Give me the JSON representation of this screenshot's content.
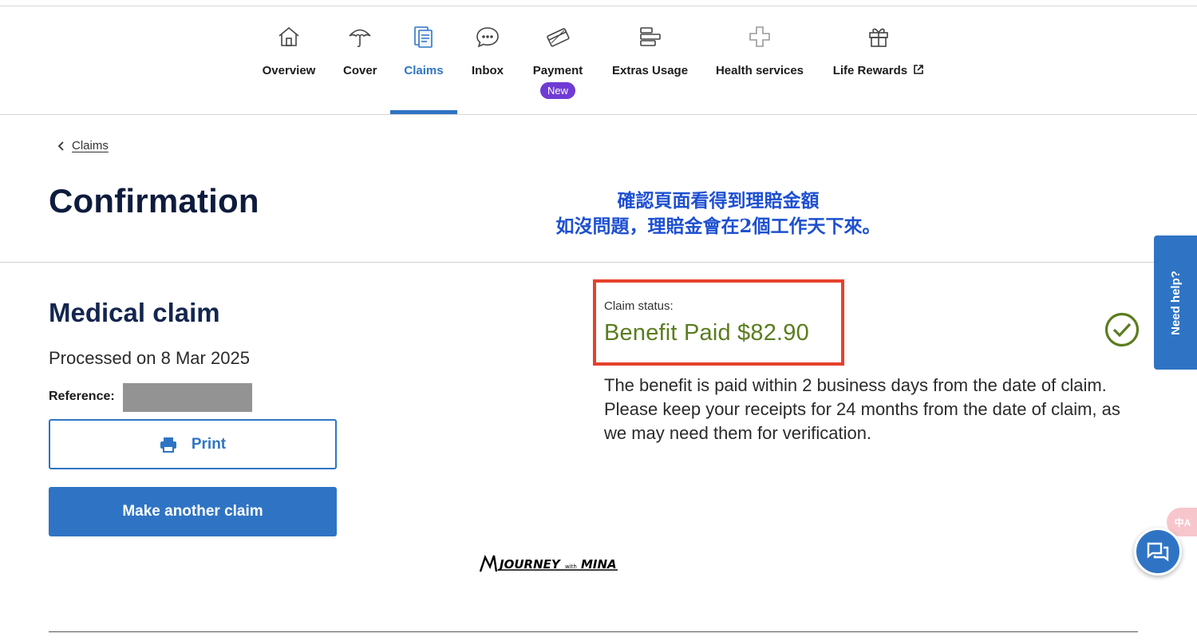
{
  "nav": {
    "items": [
      {
        "label": "Overview",
        "icon": "home-icon"
      },
      {
        "label": "Cover",
        "icon": "umbrella-icon"
      },
      {
        "label": "Claims",
        "icon": "claims-document-icon",
        "active": true
      },
      {
        "label": "Inbox",
        "icon": "chat-bubble-icon"
      },
      {
        "label": "Payment",
        "icon": "credit-card-icon",
        "badge": "New"
      },
      {
        "label": "Extras Usage",
        "icon": "usage-bars-icon"
      },
      {
        "label": "Health services",
        "icon": "health-cross-icon"
      },
      {
        "label": "Life Rewards",
        "icon": "gift-icon",
        "external": true
      }
    ]
  },
  "breadcrumb": {
    "label": "Claims"
  },
  "page": {
    "title": "Confirmation"
  },
  "note": {
    "line1": "確認頁面看得到理賠金額",
    "line2": "如沒問題，理賠金會在2個工作天下來。"
  },
  "claim": {
    "title": "Medical claim",
    "processed": "Processed on 8 Mar 2025",
    "reference_label": "Reference:",
    "print_label": "Print",
    "another_label": "Make another claim",
    "status_label": "Claim status:",
    "status_value": "Benefit Paid $82.90",
    "info": "The benefit is paid within 2 business days from the date of claim. Please keep your receipts for 24 months from the date of claim, as we may need them for verification."
  },
  "help": {
    "label": "Need help?"
  },
  "translate": {
    "label": "中A"
  },
  "watermark": {
    "text": "JOURNEY with MINA"
  },
  "colors": {
    "accent": "#2f74c4",
    "status_green": "#5a7d1e",
    "highlight_red": "#e5412c",
    "badge_purple": "#6f3bd4",
    "note_blue": "#1d4fd1"
  }
}
